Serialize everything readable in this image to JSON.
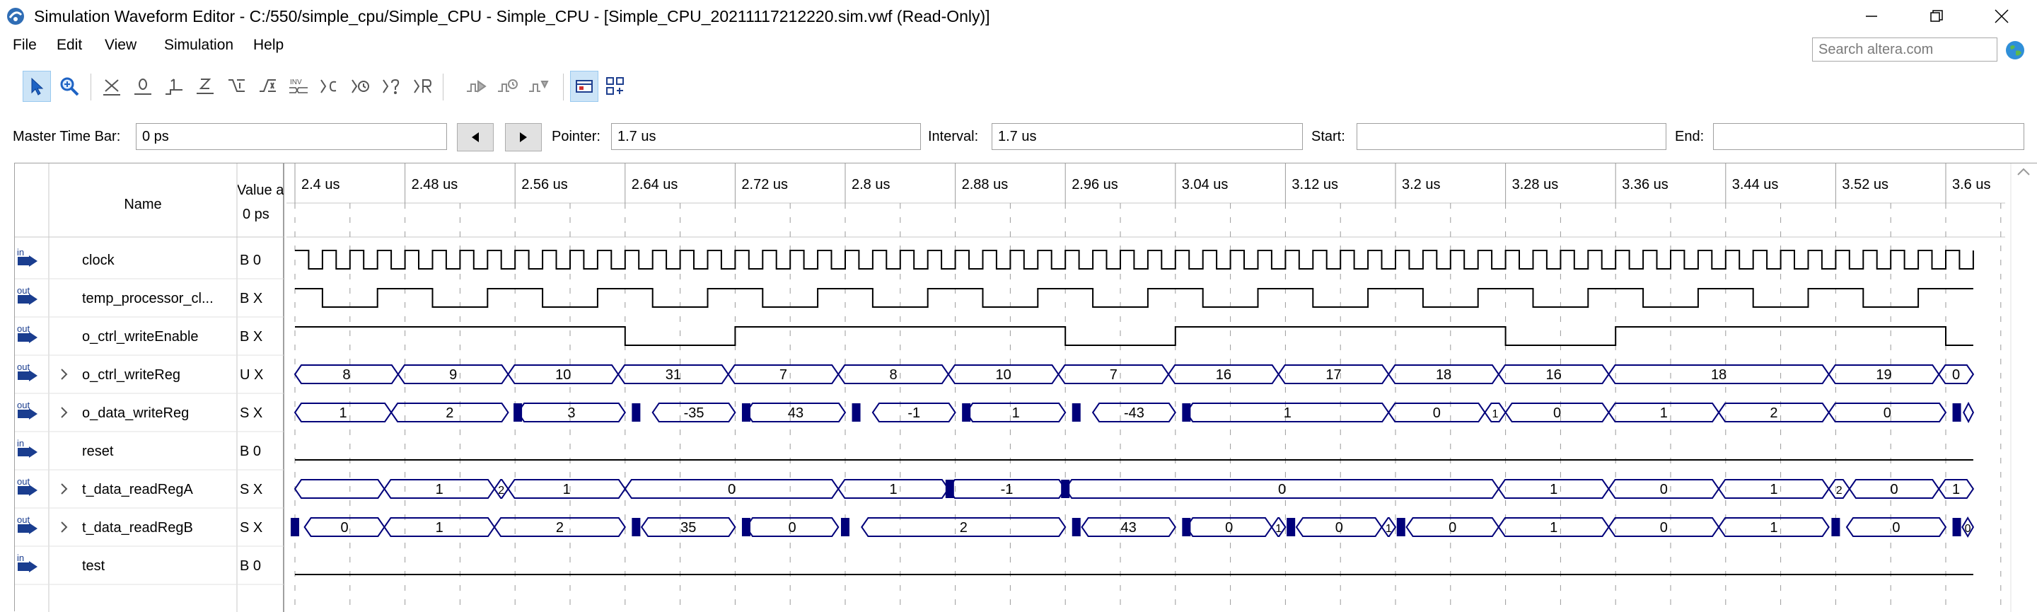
{
  "window": {
    "title": "Simulation Waveform Editor - C:/550/simple_cpu/Simple_CPU - Simple_CPU - [Simple_CPU_20211117212220.sim.vwf (Read-Only)]",
    "buttons": [
      "minimize",
      "maximize",
      "close"
    ]
  },
  "menu": [
    "File",
    "Edit",
    "View",
    "Simulation",
    "Help"
  ],
  "search": {
    "placeholder": "Search altera.com",
    "value": ""
  },
  "toolbar": {
    "icons": [
      "selection-tool-icon",
      "zoom-tool-icon",
      "forcing-unknown-icon",
      "forcing-low-icon",
      "forcing-high-icon",
      "high-impedance-icon",
      "weak-low-icon",
      "weak-high-icon",
      "invert-icon",
      "count-value-icon",
      "overwrite-clock-icon",
      "random-values-icon",
      "arbitrary-value-icon",
      "run-functional-simulation-icon",
      "run-timing-simulation-icon",
      "generate-netlist-icon",
      "snap-to-grid-icon",
      "grid-icon"
    ],
    "active": [
      "selection-tool-icon",
      "snap-to-grid-icon"
    ]
  },
  "timebar": {
    "master_label": "Master Time Bar:",
    "master_value": "0 ps",
    "pointer_label": "Pointer:",
    "pointer_value": "1.7 us",
    "interval_label": "Interval:",
    "interval_value": "1.7 us",
    "start_label": "Start:",
    "start_value": "",
    "end_label": "End:",
    "end_value": ""
  },
  "columns": {
    "name": "Name",
    "value_line1": "Value a",
    "value_line2": "0 ps"
  },
  "time_ticks": [
    "2.4 us",
    "2.48 us",
    "2.56 us",
    "2.64 us",
    "2.72 us",
    "2.8 us",
    "2.88 us",
    "2.96 us",
    "3.04 us",
    "3.12 us",
    "3.2 us",
    "3.28 us",
    "3.36 us",
    "3.44 us",
    "3.52 us",
    "3.6 us"
  ],
  "signals": [
    {
      "dir": "in",
      "name": "clock",
      "value": "B 0",
      "expandable": false,
      "kind": "clock",
      "period": 0.02,
      "start_high": true
    },
    {
      "dir": "out",
      "name": "temp_processor_cl...",
      "value": "B X",
      "expandable": false,
      "kind": "bit",
      "initial": 1,
      "transitions": [
        2.4,
        2.42,
        2.46,
        2.5,
        2.54,
        2.58,
        2.62,
        2.66,
        2.7,
        2.74,
        2.78,
        2.82,
        2.86,
        2.9,
        2.94,
        2.98,
        3.02,
        3.06,
        3.1,
        3.14,
        3.18,
        3.22,
        3.26,
        3.3,
        3.34,
        3.38,
        3.42,
        3.46,
        3.5,
        3.54,
        3.58,
        3.62
      ]
    },
    {
      "dir": "out",
      "name": "o_ctrl_writeEnable",
      "value": "B X",
      "expandable": false,
      "kind": "bit",
      "initial": 1,
      "transitions": [
        2.64,
        2.72,
        2.96,
        3.04,
        3.28,
        3.36,
        3.6
      ]
    },
    {
      "dir": "out",
      "name": "o_ctrl_writeReg",
      "value": "U X",
      "expandable": true,
      "kind": "bus",
      "segments": [
        {
          "from": 2.4,
          "to": 2.475,
          "label": "8"
        },
        {
          "from": 2.475,
          "to": 2.555,
          "label": "9"
        },
        {
          "from": 2.555,
          "to": 2.635,
          "label": "10"
        },
        {
          "from": 2.635,
          "to": 2.715,
          "label": "31"
        },
        {
          "from": 2.715,
          "to": 2.795,
          "label": "7"
        },
        {
          "from": 2.795,
          "to": 2.875,
          "label": "8"
        },
        {
          "from": 2.875,
          "to": 2.955,
          "label": "10"
        },
        {
          "from": 2.955,
          "to": 3.035,
          "label": "7"
        },
        {
          "from": 3.035,
          "to": 3.115,
          "label": "16"
        },
        {
          "from": 3.115,
          "to": 3.195,
          "label": "17"
        },
        {
          "from": 3.195,
          "to": 3.275,
          "label": "18"
        },
        {
          "from": 3.275,
          "to": 3.355,
          "label": "16"
        },
        {
          "from": 3.355,
          "to": 3.515,
          "label": "18"
        },
        {
          "from": 3.515,
          "to": 3.595,
          "label": "19"
        },
        {
          "from": 3.595,
          "to": 3.62,
          "label": "0"
        }
      ]
    },
    {
      "dir": "out",
      "name": "o_data_writeReg",
      "value": "S X",
      "expandable": true,
      "kind": "bus",
      "segments": [
        {
          "from": 2.4,
          "to": 2.47,
          "label": "1"
        },
        {
          "from": 2.47,
          "to": 2.555,
          "label": "2"
        },
        {
          "from": 2.562,
          "to": 2.64,
          "label": "3"
        },
        {
          "from": 2.66,
          "to": 2.72,
          "label": "-35"
        },
        {
          "from": 2.728,
          "to": 2.8,
          "label": "43"
        },
        {
          "from": 2.82,
          "to": 2.88,
          "label": "-1"
        },
        {
          "from": 2.888,
          "to": 2.96,
          "label": "1"
        },
        {
          "from": 2.98,
          "to": 3.04,
          "label": "-43"
        },
        {
          "from": 3.048,
          "to": 3.195,
          "label": "1"
        },
        {
          "from": 3.195,
          "to": 3.265,
          "label": "0"
        },
        {
          "from": 3.265,
          "to": 3.28,
          "label": "1"
        },
        {
          "from": 3.28,
          "to": 3.355,
          "label": "0"
        },
        {
          "from": 3.355,
          "to": 3.435,
          "label": "1"
        },
        {
          "from": 3.435,
          "to": 3.515,
          "label": "2"
        },
        {
          "from": 3.515,
          "to": 3.6,
          "label": "0"
        },
        {
          "from": 3.613,
          "to": 3.62,
          "label": ""
        }
      ],
      "glitches": [
        2.562,
        2.648,
        2.728,
        2.808,
        2.888,
        2.968,
        3.048,
        3.608
      ]
    },
    {
      "dir": "in",
      "name": "reset",
      "value": "B 0",
      "expandable": false,
      "kind": "bit",
      "initial": 0,
      "transitions": []
    },
    {
      "dir": "out",
      "name": "t_data_readRegA",
      "value": "S X",
      "expandable": true,
      "kind": "bus",
      "segments": [
        {
          "from": 2.4,
          "to": 2.465,
          "label": ""
        },
        {
          "from": 2.465,
          "to": 2.545,
          "label": "1"
        },
        {
          "from": 2.545,
          "to": 2.555,
          "label": "2"
        },
        {
          "from": 2.555,
          "to": 2.64,
          "label": "1"
        },
        {
          "from": 2.64,
          "to": 2.795,
          "label": "0"
        },
        {
          "from": 2.795,
          "to": 2.875,
          "label": "1"
        },
        {
          "from": 2.875,
          "to": 2.96,
          "label": "-1"
        },
        {
          "from": 2.96,
          "to": 3.275,
          "label": "0"
        },
        {
          "from": 3.275,
          "to": 3.355,
          "label": "1"
        },
        {
          "from": 3.355,
          "to": 3.435,
          "label": "0"
        },
        {
          "from": 3.435,
          "to": 3.515,
          "label": "1"
        },
        {
          "from": 3.515,
          "to": 3.53,
          "label": "2"
        },
        {
          "from": 3.53,
          "to": 3.595,
          "label": "0"
        },
        {
          "from": 3.595,
          "to": 3.62,
          "label": "1"
        }
      ],
      "glitches": [
        2.876,
        2.96
      ]
    },
    {
      "dir": "out",
      "name": "t_data_readRegB",
      "value": "S X",
      "expandable": true,
      "kind": "bus",
      "segments": [
        {
          "from": 2.407,
          "to": 2.465,
          "label": "0"
        },
        {
          "from": 2.465,
          "to": 2.545,
          "label": "1"
        },
        {
          "from": 2.545,
          "to": 2.64,
          "label": "2"
        },
        {
          "from": 2.652,
          "to": 2.72,
          "label": "35"
        },
        {
          "from": 2.728,
          "to": 2.795,
          "label": "0"
        },
        {
          "from": 2.812,
          "to": 2.96,
          "label": "2"
        },
        {
          "from": 2.972,
          "to": 3.04,
          "label": "43"
        },
        {
          "from": 3.048,
          "to": 3.11,
          "label": "0"
        },
        {
          "from": 3.11,
          "to": 3.12,
          "label": "1"
        },
        {
          "from": 3.128,
          "to": 3.19,
          "label": "0"
        },
        {
          "from": 3.19,
          "to": 3.2,
          "label": "1"
        },
        {
          "from": 3.208,
          "to": 3.275,
          "label": "0"
        },
        {
          "from": 3.275,
          "to": 3.355,
          "label": "1"
        },
        {
          "from": 3.355,
          "to": 3.435,
          "label": "0"
        },
        {
          "from": 3.435,
          "to": 3.515,
          "label": "1"
        },
        {
          "from": 3.528,
          "to": 3.6,
          "label": "0"
        },
        {
          "from": 3.612,
          "to": 3.62,
          "label": "0"
        }
      ],
      "glitches": [
        2.4,
        2.648,
        2.728,
        2.8,
        2.968,
        3.048,
        3.124,
        3.204,
        3.52,
        3.608
      ]
    },
    {
      "dir": "in",
      "name": "test",
      "value": "B 0",
      "expandable": false,
      "kind": "bit",
      "initial": 0,
      "transitions": []
    }
  ],
  "colors": {
    "bus": "#00007a",
    "grid": "#9a9a9a",
    "line": "#000000",
    "icon": "#1a3d8f"
  }
}
